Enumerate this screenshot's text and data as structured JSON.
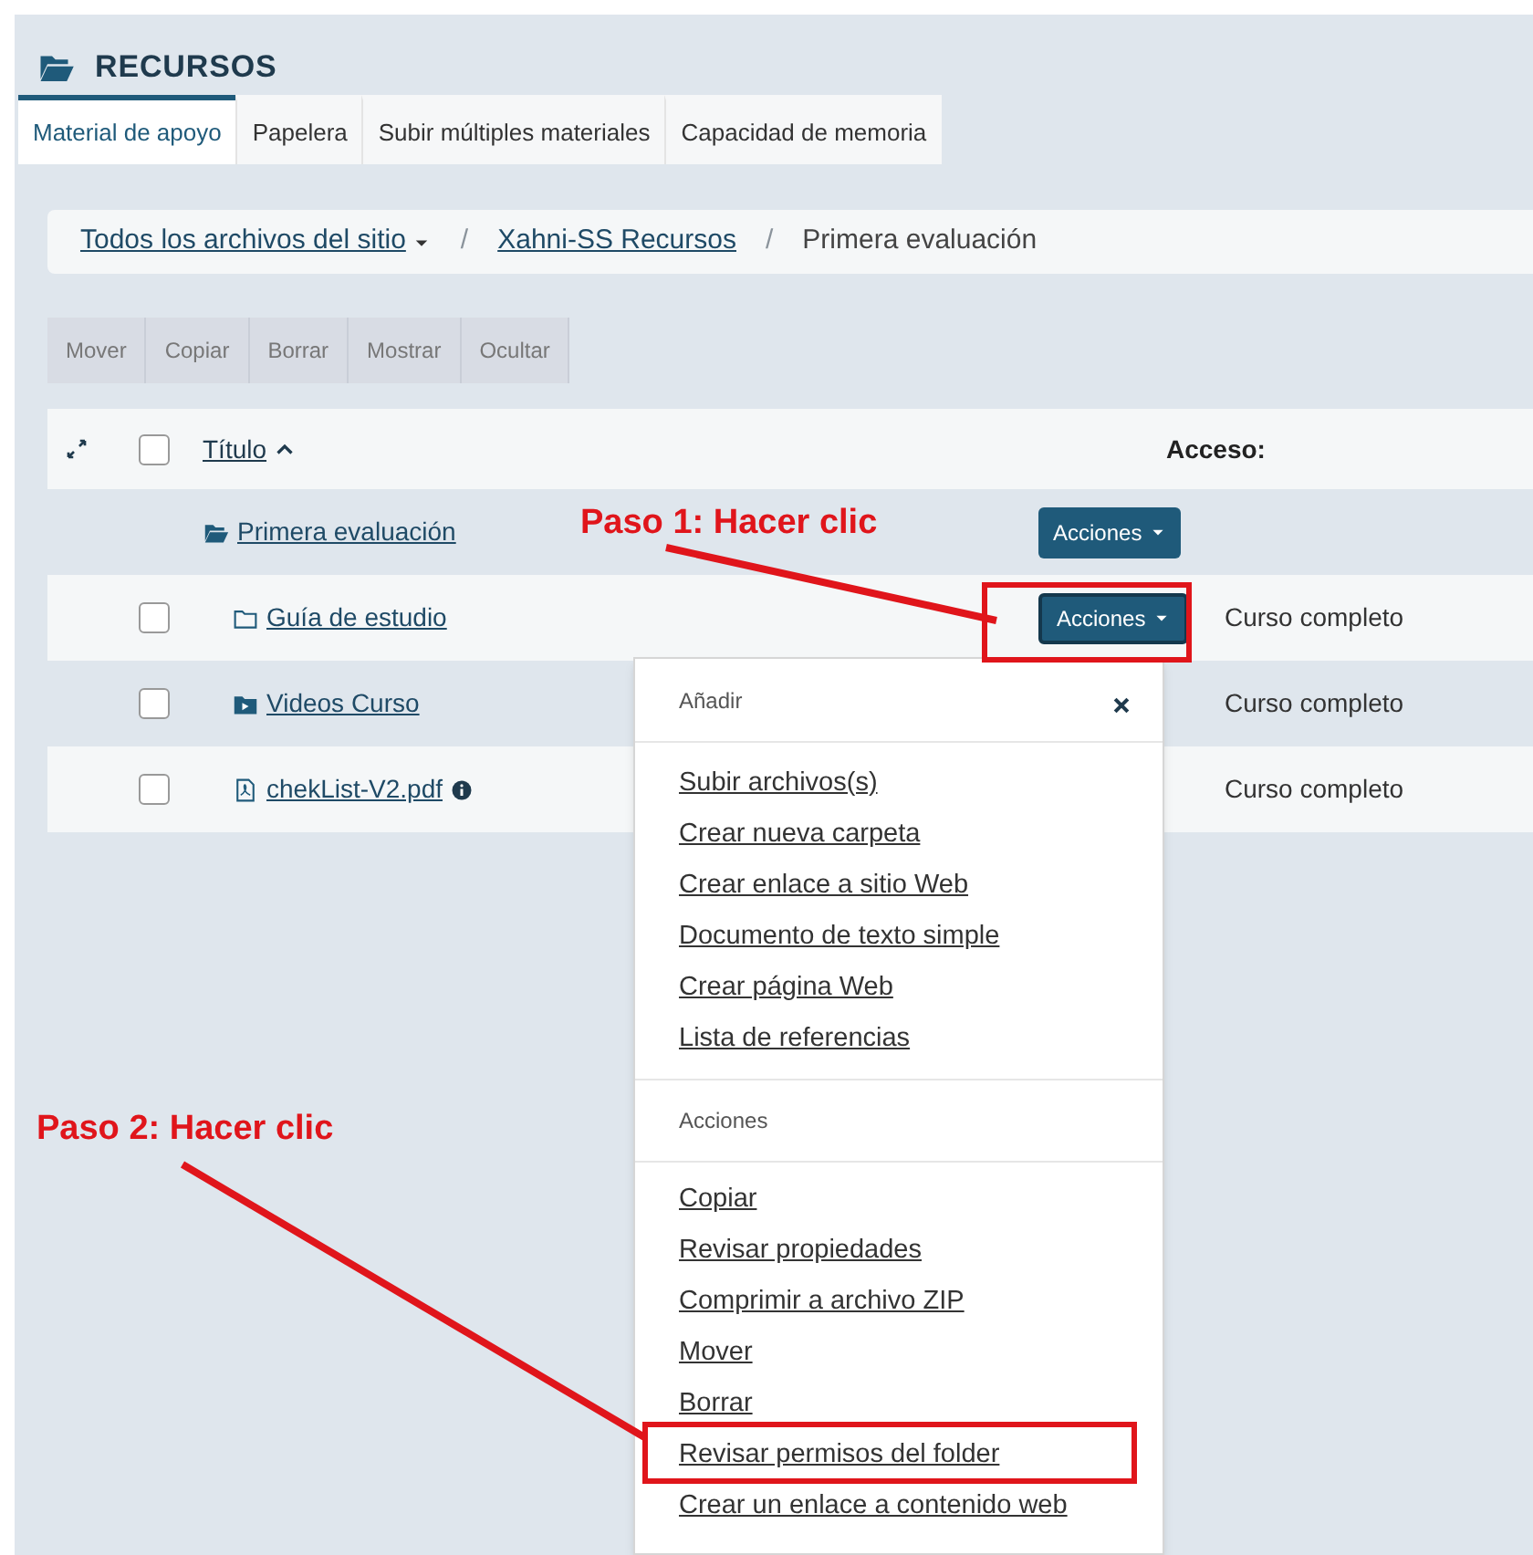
{
  "header": {
    "title": "RECURSOS"
  },
  "tabs": [
    {
      "label": "Material de apoyo",
      "selected": true
    },
    {
      "label": "Papelera",
      "selected": false
    },
    {
      "label": "Subir múltiples materiales",
      "selected": false
    },
    {
      "label": "Capacidad de memoria",
      "selected": false
    }
  ],
  "breadcrumb": [
    {
      "label": "Todos los archivos del sitio",
      "kind": "dropdown"
    },
    {
      "label": "Xahni-SS Recursos",
      "kind": "link"
    },
    {
      "label": "Primera evaluación",
      "kind": "current"
    }
  ],
  "breadcrumb_separator": "/",
  "toolbar": [
    "Mover",
    "Copiar",
    "Borrar",
    "Mostrar",
    "Ocultar"
  ],
  "table": {
    "columns": {
      "title": "Título",
      "access": "Acceso:"
    },
    "select_all_checked": false,
    "rows": [
      {
        "kind": "parent",
        "title": "Primera evaluación",
        "actions": "Acciones",
        "focused": false
      },
      {
        "kind": "folder",
        "title": "Guía de estudio",
        "actions": "Acciones",
        "focused": true,
        "access": "Curso completo",
        "checked": false
      },
      {
        "kind": "media-folder",
        "title": "Videos Curso",
        "access": "Curso completo",
        "checked": false
      },
      {
        "kind": "file",
        "title": "chekList-V2.pdf",
        "info": true,
        "access": "Curso completo",
        "checked": false
      }
    ]
  },
  "menu": {
    "sections": [
      {
        "heading": "Añadir",
        "closable": true,
        "items": [
          "Subir archivos(s)",
          "Crear nueva carpeta",
          "Crear enlace a sitio Web",
          "Documento de texto simple",
          "Crear página Web",
          "Lista de referencias"
        ]
      },
      {
        "heading": "Acciones",
        "closable": false,
        "items": [
          "Copiar",
          "Revisar propiedades",
          "Comprimir a archivo ZIP",
          "Mover",
          "Borrar",
          "Revisar permisos del folder",
          "Crear un enlace a contenido web"
        ]
      }
    ]
  },
  "annotations": [
    {
      "text": "Paso 1: Hacer clic"
    },
    {
      "text": "Paso 2: Hacer clic"
    }
  ]
}
